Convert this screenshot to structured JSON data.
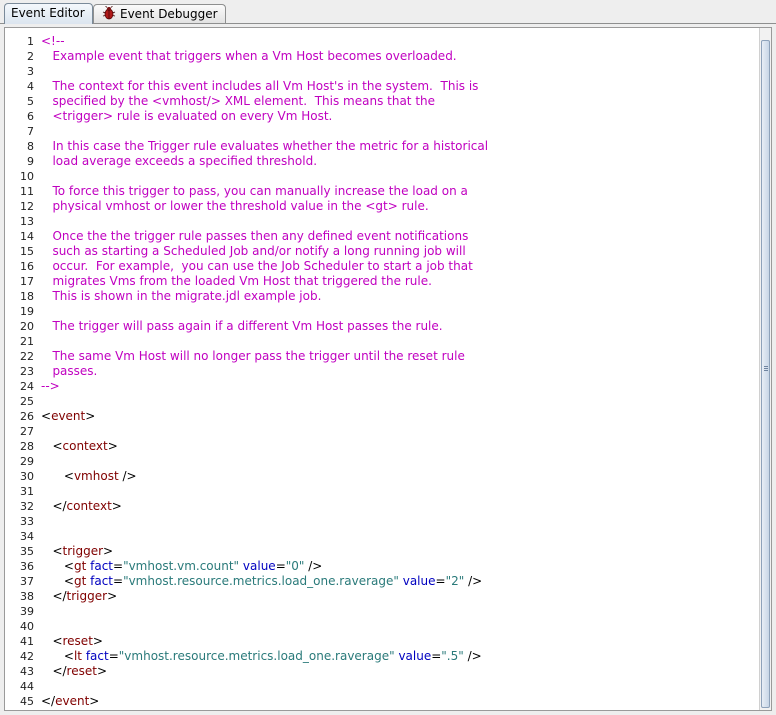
{
  "tabs": [
    {
      "label": "Event Editor",
      "selected": true
    },
    {
      "label": "Event Debugger",
      "selected": false,
      "icon": "bug-icon"
    }
  ],
  "editor": {
    "line_numbers": [
      "1",
      "2",
      "3",
      "4",
      "5",
      "6",
      "7",
      "8",
      "9",
      "10",
      "11",
      "12",
      "13",
      "14",
      "15",
      "16",
      "17",
      "18",
      "19",
      "20",
      "21",
      "22",
      "23",
      "24",
      "25",
      "26",
      "27",
      "28",
      "29",
      "30",
      "31",
      "32",
      "33",
      "34",
      "35",
      "36",
      "37",
      "38",
      "39",
      "40",
      "41",
      "42",
      "43",
      "44",
      "45"
    ],
    "lines": [
      [
        {
          "t": "<!--",
          "c": "comment"
        }
      ],
      [
        {
          "t": "   Example event that triggers when a Vm Host becomes overloaded.",
          "c": "comment"
        }
      ],
      [],
      [
        {
          "t": "   The context for this event includes all Vm Host's in the system.  This is",
          "c": "comment"
        }
      ],
      [
        {
          "t": "   specified by the <vmhost/> XML element.  This means that the",
          "c": "comment"
        }
      ],
      [
        {
          "t": "   <trigger> rule is evaluated on every Vm Host.",
          "c": "comment"
        }
      ],
      [],
      [
        {
          "t": "   In this case the Trigger rule evaluates whether the metric for a historical",
          "c": "comment"
        }
      ],
      [
        {
          "t": "   load average exceeds a specified threshold.",
          "c": "comment"
        }
      ],
      [],
      [
        {
          "t": "   To force this trigger to pass, you can manually increase the load on a",
          "c": "comment"
        }
      ],
      [
        {
          "t": "   physical vmhost or lower the threshold value in the <gt> rule.",
          "c": "comment"
        }
      ],
      [],
      [
        {
          "t": "   Once the the trigger rule passes then any defined event notifications",
          "c": "comment"
        }
      ],
      [
        {
          "t": "   such as starting a Scheduled Job and/or notify a long running job will",
          "c": "comment"
        }
      ],
      [
        {
          "t": "   occur.  For example,  you can use the Job Scheduler to start a job that",
          "c": "comment"
        }
      ],
      [
        {
          "t": "   migrates Vms from the loaded Vm Host that triggered the rule.",
          "c": "comment"
        }
      ],
      [
        {
          "t": "   This is shown in the migrate.jdl example job.",
          "c": "comment"
        }
      ],
      [],
      [
        {
          "t": "   The trigger will pass again if a different Vm Host passes the rule.",
          "c": "comment"
        }
      ],
      [],
      [
        {
          "t": "   The same Vm Host will no longer pass the trigger until the reset rule",
          "c": "comment"
        }
      ],
      [
        {
          "t": "   passes.",
          "c": "comment"
        }
      ],
      [
        {
          "t": "-->",
          "c": "comment"
        }
      ],
      [],
      [
        {
          "t": "<",
          "c": "text"
        },
        {
          "t": "event",
          "c": "tag"
        },
        {
          "t": ">",
          "c": "text"
        }
      ],
      [],
      [
        {
          "t": "   <",
          "c": "text"
        },
        {
          "t": "context",
          "c": "tag"
        },
        {
          "t": ">",
          "c": "text"
        }
      ],
      [],
      [
        {
          "t": "      <",
          "c": "text"
        },
        {
          "t": "vmhost",
          "c": "tag"
        },
        {
          "t": " />",
          "c": "text"
        }
      ],
      [],
      [
        {
          "t": "   </",
          "c": "text"
        },
        {
          "t": "context",
          "c": "tag"
        },
        {
          "t": ">",
          "c": "text"
        }
      ],
      [],
      [],
      [
        {
          "t": "   <",
          "c": "text"
        },
        {
          "t": "trigger",
          "c": "tag"
        },
        {
          "t": ">",
          "c": "text"
        }
      ],
      [
        {
          "t": "      <",
          "c": "text"
        },
        {
          "t": "gt",
          "c": "tag"
        },
        {
          "t": " ",
          "c": "text"
        },
        {
          "t": "fact",
          "c": "attr"
        },
        {
          "t": "=",
          "c": "text"
        },
        {
          "t": "\"vmhost.vm.count\"",
          "c": "val"
        },
        {
          "t": " ",
          "c": "text"
        },
        {
          "t": "value",
          "c": "attr"
        },
        {
          "t": "=",
          "c": "text"
        },
        {
          "t": "\"0\"",
          "c": "val"
        },
        {
          "t": " />",
          "c": "text"
        }
      ],
      [
        {
          "t": "      <",
          "c": "text"
        },
        {
          "t": "gt",
          "c": "tag"
        },
        {
          "t": " ",
          "c": "text"
        },
        {
          "t": "fact",
          "c": "attr"
        },
        {
          "t": "=",
          "c": "text"
        },
        {
          "t": "\"vmhost.resource.metrics.load_one.raverage\"",
          "c": "val"
        },
        {
          "t": " ",
          "c": "text"
        },
        {
          "t": "value",
          "c": "attr"
        },
        {
          "t": "=",
          "c": "text"
        },
        {
          "t": "\"2\"",
          "c": "val"
        },
        {
          "t": " />",
          "c": "text"
        }
      ],
      [
        {
          "t": "   </",
          "c": "text"
        },
        {
          "t": "trigger",
          "c": "tag"
        },
        {
          "t": ">",
          "c": "text"
        }
      ],
      [],
      [],
      [
        {
          "t": "   <",
          "c": "text"
        },
        {
          "t": "reset",
          "c": "tag"
        },
        {
          "t": ">",
          "c": "text"
        }
      ],
      [
        {
          "t": "      <",
          "c": "text"
        },
        {
          "t": "lt",
          "c": "tag"
        },
        {
          "t": " ",
          "c": "text"
        },
        {
          "t": "fact",
          "c": "attr"
        },
        {
          "t": "=",
          "c": "text"
        },
        {
          "t": "\"vmhost.resource.metrics.load_one.raverage\"",
          "c": "val"
        },
        {
          "t": " ",
          "c": "text"
        },
        {
          "t": "value",
          "c": "attr"
        },
        {
          "t": "=",
          "c": "text"
        },
        {
          "t": "\".5\"",
          "c": "val"
        },
        {
          "t": " />",
          "c": "text"
        }
      ],
      [
        {
          "t": "   </",
          "c": "text"
        },
        {
          "t": "reset",
          "c": "tag"
        },
        {
          "t": ">",
          "c": "text"
        }
      ],
      [],
      [
        {
          "t": "</",
          "c": "text"
        },
        {
          "t": "event",
          "c": "tag"
        },
        {
          "t": ">",
          "c": "text"
        }
      ]
    ]
  },
  "colors": {
    "comment": "#c000c0",
    "tag": "#800000",
    "attr": "#0000c0",
    "value": "#2a7a7a"
  }
}
